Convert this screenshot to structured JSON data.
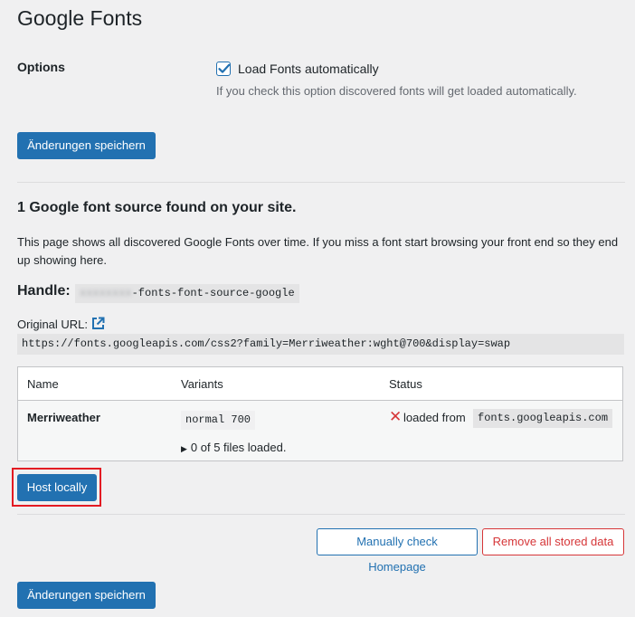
{
  "page": {
    "title": "Google Fonts"
  },
  "options": {
    "label": "Options",
    "load_fonts": {
      "checked": true,
      "label": "Load Fonts automatically",
      "description": "If you check this option discovered fonts will get loaded automatically."
    }
  },
  "save_button_label": "Änderungen speichern",
  "sources": {
    "heading": "1 Google font source found on your site.",
    "description": "This page shows all discovered Google Fonts over time. If you miss a font start browsing your front end so they end up showing here.",
    "handle_label": "Handle:",
    "handle_visible": "-fonts-font-source-google",
    "original_url_label": "Original URL:",
    "original_url": "https://fonts.googleapis.com/css2?family=Merriweather:wght@700&display=swap"
  },
  "table": {
    "headers": {
      "name": "Name",
      "variants": "Variants",
      "status": "Status"
    },
    "rows": [
      {
        "name": "Merriweather",
        "variant": "normal 700",
        "files": "0 of 5 files loaded.",
        "status_text": "loaded from",
        "status_host": "fonts.googleapis.com"
      }
    ]
  },
  "actions": {
    "host_locally": "Host locally",
    "manual_check": "Manually check Homepage",
    "remove_data": "Remove all stored data"
  },
  "colors": {
    "primary": "#2271b1",
    "danger": "#d63638",
    "highlight": "#e31b23"
  },
  "icons": {
    "checkbox": "check-icon",
    "external_link": "external-link-icon",
    "status": "x-icon",
    "disclosure": "triangle-right-icon"
  }
}
